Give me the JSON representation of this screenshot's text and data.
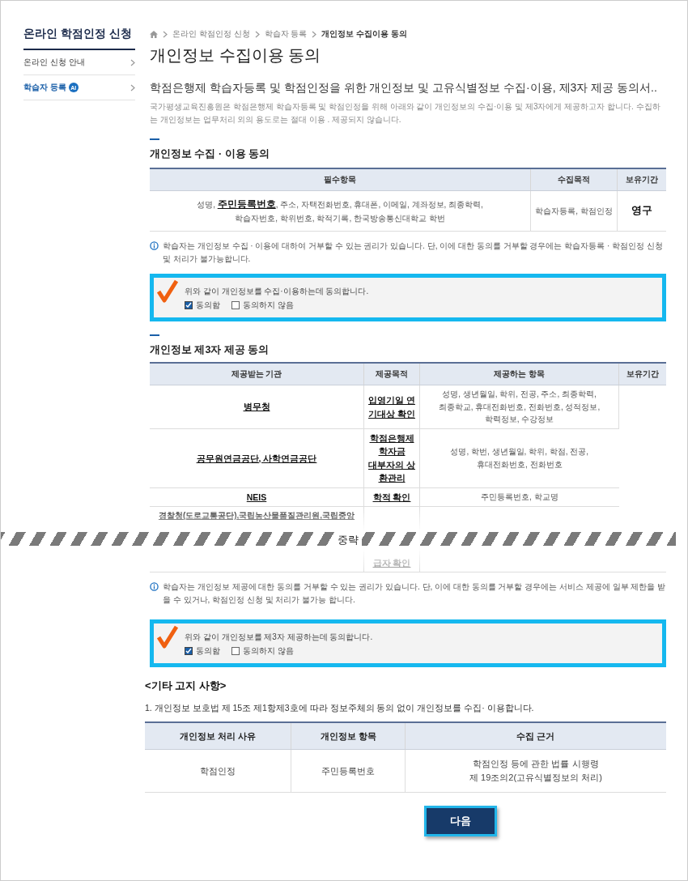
{
  "sidebar": {
    "title": "온라인 학점인정 신청",
    "items": [
      {
        "label": "온라인 신청 안내",
        "selected": false
      },
      {
        "label": "학습자 등록",
        "badge": "AI",
        "selected": true
      }
    ]
  },
  "breadcrumb": [
    "온라인 학점인정 신청",
    "학습자 등록",
    "개인정보 수집이용 동의"
  ],
  "page_title": "개인정보 수집이용 동의",
  "intro": {
    "heading": "학점은행제 학습자등록 및 학점인정을 위한 개인정보 및 고유식별정보 수집·이용, 제3자 제공 동의서..",
    "text": "국가평생교육진흥원은 학점은행제 학습자등록 및 학점인정을 위해 아래와 같이 개인정보의 수집·이용 및 제3자에게 제공하고자 합니다. 수집하는 개인정보는 업무처리 외의 용도로는 절대 이용 . 제공되지 않습니다."
  },
  "collection": {
    "title": "개인정보 수집 · 이용 동의",
    "columns": [
      "필수항목",
      "수집목적",
      "보유기간"
    ],
    "row": {
      "items": [
        "성명, **주민등록번호**, 주소, 자택전화번호, 휴대폰, 이메일, 계좌정보, 최종학력,",
        "학습자번호, 학위번호, 학적기록, 한국방송통신대학교 학번"
      ],
      "purpose": "학습자등록, 학점인정",
      "retention": "영구"
    },
    "notice": "학습자는 개인정보 수집 · 이용에 대하여 거부할 수 있는 권리가 있습니다. 단, 이에 대한 동의를 거부할 경우에는 학습자등록 · 학점인정 신청 및 처리가 불가능합니다.",
    "consent": {
      "text": "위와 같이 개인정보를 수집·이용하는데 동의합니다.",
      "options": [
        {
          "label": "동의함",
          "checked": true
        },
        {
          "label": "동의하지 않음",
          "checked": false
        }
      ]
    }
  },
  "third_party": {
    "title": "개인정보 제3자 제공 동의",
    "columns": [
      "제공받는 기관",
      "제공목적",
      "제공하는 항목",
      "보유기간"
    ],
    "rows": [
      {
        "organization": [
          "병무청"
        ],
        "purpose": [
          "입영기일 연",
          "기대상 확인"
        ],
        "items": [
          "성명, 생년월일, 학위, 전공, 주소, 최종학력,",
          "최종학교, 휴대전화번호, 전화번호, 성적정보,",
          "학력정보, 수강정보"
        ]
      },
      {
        "organization": [
          "공무원연금공단, 사학연금공단"
        ],
        "purpose": [
          "학점은행제",
          "학자금",
          "대부자의 상",
          "환관리"
        ],
        "items": [
          "성명, 학번, 생년월일, 학위, 학점, 전공,",
          "휴대전화번호, 전화번호"
        ]
      },
      {
        "organization": [
          "NEIS"
        ],
        "purpose": [
          "학적 확인"
        ],
        "items": [
          "주민등록번호, 학교명"
        ]
      },
      {
        "organization": [
          "경찰청(도로교통공단),국립농산물품질관리원,국립중앙"
        ],
        "purpose": [
          "급자 확인"
        ],
        "items": []
      }
    ],
    "omission": "중략",
    "notice": "학습자는 개인정보 제공에 대한 동의를 거부할 수 있는 권리가 있습니다. 단, 이에 대한 동의를 거부할 경우에는 서비스 제공에 일부 제한을 받을 수 있거나, 학점인정 신청 및 처리가 불가능 합니다.",
    "consent": {
      "text": "위와 같이 개인정보를 제3자 제공하는데 동의합니다.",
      "options": [
        {
          "label": "동의함",
          "checked": true
        },
        {
          "label": "동의하지 않음",
          "checked": false
        }
      ]
    }
  },
  "other_notice": {
    "title": "<기타 고지 사항>",
    "item": "1.  개인정보 보호법 제 15조 제1항제3호에 따라 정보주체의 동의 없이 개인정보를 수집· 이용합니다.",
    "columns": [
      "개인정보 처리 사유",
      "개인정보 항목",
      "수집 근거"
    ],
    "row": {
      "reason": "학점인정",
      "item": "주민등록번호",
      "basis": [
        "학점인정 등에 관한 법률 시행령",
        "제 19조의2(고유식별정보의 처리)"
      ]
    }
  },
  "next_button": "다음"
}
